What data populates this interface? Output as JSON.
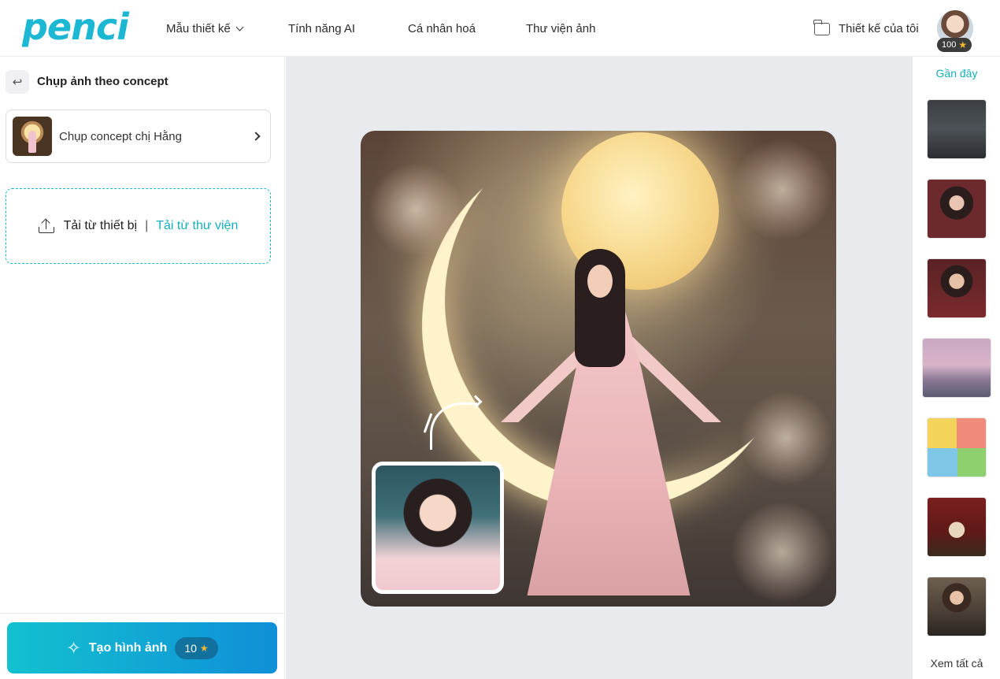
{
  "header": {
    "logo": "penci",
    "nav": [
      {
        "label": "Mẫu thiết kế",
        "has_dropdown": true
      },
      {
        "label": "Tính năng AI"
      },
      {
        "label": "Cá nhân hoá"
      },
      {
        "label": "Thư viện ảnh"
      }
    ],
    "my_designs_label": "Thiết kế của tôi",
    "credits": "100"
  },
  "left_panel": {
    "title": "Chụp ảnh theo concept",
    "concept_label": "Chụp concept chị Hằng",
    "upload_device_label": "Tải từ thiết bị",
    "upload_separator": "|",
    "upload_library_label": "Tải từ thư viện",
    "create_button_label": "Tạo hình ảnh",
    "create_cost": "10"
  },
  "right_panel": {
    "recent_title": "Gần đây",
    "see_all_label": "Xem tất cả",
    "thumb_count_visible": 7
  },
  "colors": {
    "brand": "#1bb7d3",
    "accent_link": "#18aeb9",
    "button_gradient_start": "#13c1cf",
    "button_gradient_end": "#0f8fd8",
    "canvas_bg": "#e9eaee"
  }
}
